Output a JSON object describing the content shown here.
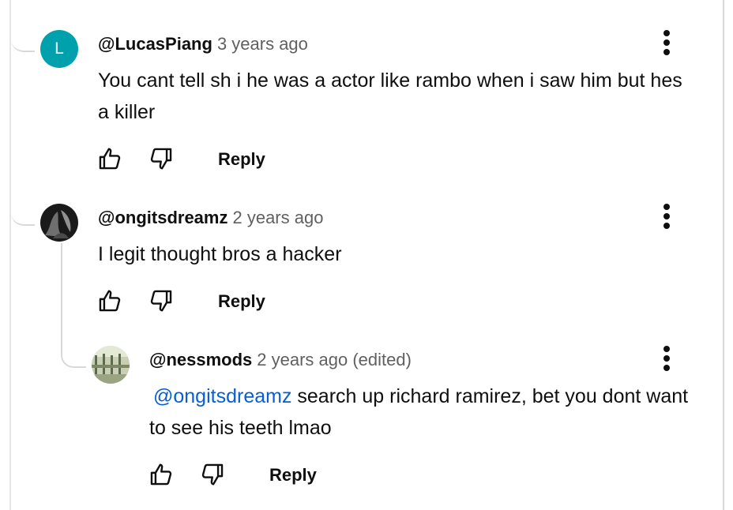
{
  "comments": [
    {
      "author": "@LucasPiang",
      "time": "3 years ago",
      "avatar_letter": "L",
      "text": "You cant tell sh i he was a actor like rambo when i saw him but hes a killer",
      "reply_label": "Reply"
    },
    {
      "author": "@ongitsdreamz",
      "time": "2 years ago",
      "text": "I legit thought bros a hacker",
      "reply_label": "Reply"
    },
    {
      "author": "@nessmods",
      "time": "2 years ago (edited)",
      "mention": "@ongitsdreamz",
      "text": " search up richard ramirez, bet you dont want to see his teeth lmao",
      "reply_label": "Reply"
    }
  ],
  "icons": {
    "like": "thumb-up-icon",
    "dislike": "thumb-down-icon",
    "menu": "more-vert-icon"
  },
  "colors": {
    "avatar_bg": "#00a0ac",
    "mention": "#065fd4"
  }
}
